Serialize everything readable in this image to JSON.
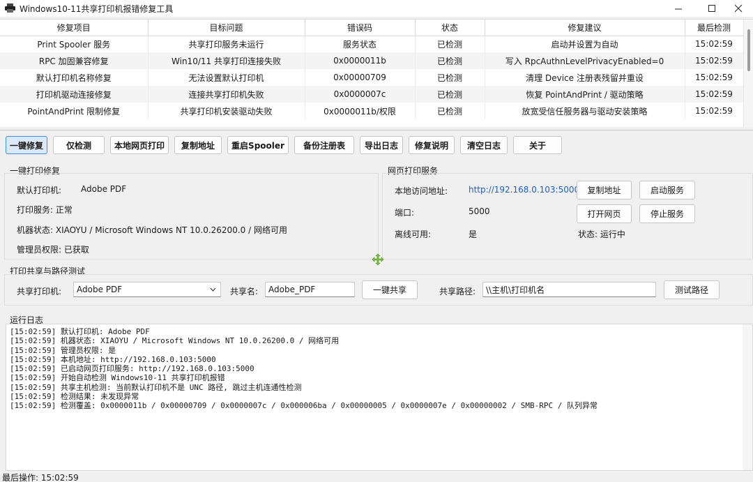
{
  "window": {
    "title": "Windows10-11共享打印机报错修复工具"
  },
  "table": {
    "headers": [
      "修复项目",
      "目标问题",
      "错误码",
      "状态",
      "修复建议",
      "最后检测"
    ],
    "rows": [
      [
        "Print Spooler 服务",
        "共享打印服务未运行",
        "服务状态",
        "已检测",
        "启动并设置为自动",
        "15:02:59"
      ],
      [
        "RPC 加固兼容修复",
        "Win10/11 共享打印连接失败",
        "0x0000011b",
        "已检测",
        "写入 RpcAuthnLevelPrivacyEnabled=0",
        "15:02:59"
      ],
      [
        "默认打印机名称修复",
        "无法设置默认打印机",
        "0x00000709",
        "已检测",
        "清理 Device 注册表残留并重设",
        "15:02:59"
      ],
      [
        "打印机驱动连接修复",
        "连接共享打印机失败",
        "0x0000007c",
        "已检测",
        "恢复 PointAndPrint / 驱动策略",
        "15:02:59"
      ],
      [
        "PointAndPrint 限制修复",
        "共享打印机安装驱动失败",
        "0x0000011b/权限",
        "已检测",
        "放宽受信任服务器与驱动安装策略",
        "15:02:59"
      ]
    ]
  },
  "toolbar": {
    "buttons": [
      "一键修复",
      "仅检测",
      "本地网页打印",
      "复制地址",
      "重启Spooler",
      "备份注册表",
      "导出日志",
      "修复说明",
      "清空日志",
      "关于"
    ]
  },
  "repair_panel": {
    "title": "一键打印修复",
    "default_printer_label": "默认打印机:",
    "default_printer_value": "Adobe PDF",
    "print_service": "打印服务: 正常",
    "machine_status": "机器状态: XIAOYU / Microsoft Windows NT 10.0.26200.0 / 网络可用",
    "admin": "管理员权限: 已获取"
  },
  "web_panel": {
    "title": "网页打印服务",
    "address_label": "本地访问地址:",
    "address_value": "http://192.168.0.103:5000",
    "port_label": "端口:",
    "port_value": "5000",
    "offline_label": "离线可用:",
    "offline_value": "是",
    "status": "状态: 运行中",
    "copy_button": "复制地址",
    "start_button": "启动服务",
    "open_button": "打开网页",
    "stop_button": "停止服务"
  },
  "share_panel": {
    "title": "打印共享与路径测试",
    "printer_label": "共享打印机:",
    "printer_value": "Adobe PDF",
    "share_name_label": "共享名:",
    "share_name_value": "Adobe_PDF",
    "share_button": "一键共享",
    "path_label": "共享路径:",
    "path_value": "\\\\主机\\打印机名",
    "test_button": "测试路径"
  },
  "log": {
    "title": "运行日志",
    "lines": [
      "[15:02:59] 默认打印机: Adobe PDF",
      "[15:02:59] 机器状态: XIAOYU / Microsoft Windows NT 10.0.26200.0 / 网络可用",
      "[15:02:59] 管理员权限: 是",
      "[15:02:59] 本机地址: http://192.168.0.103:5000",
      "[15:02:59] 已启动网页打印服务: http://192.168.0.103:5000",
      "[15:02:59] 开始自动检测 Windows10-11 共享打印机报错",
      "[15:02:59] 共享主机检测: 当前默认打印机不是 UNC 路径, 跳过主机连通性检测",
      "[15:02:59] 检测结果: 未发现异常",
      "[15:02:59] 检测覆盖: 0x0000011b / 0x00000709 / 0x0000007c / 0x000006ba / 0x00000005 / 0x0000007e / 0x00000002 / SMB-RPC / 队列异常"
    ]
  },
  "statusbar": {
    "text": "最后操作: 15:02:59"
  },
  "colors": {
    "accent": "#3a8de8",
    "link": "#1f5fbf",
    "move_icon": "#7ac143"
  },
  "icons": {
    "app": "printer-icon",
    "move": "move-cursor-icon"
  }
}
